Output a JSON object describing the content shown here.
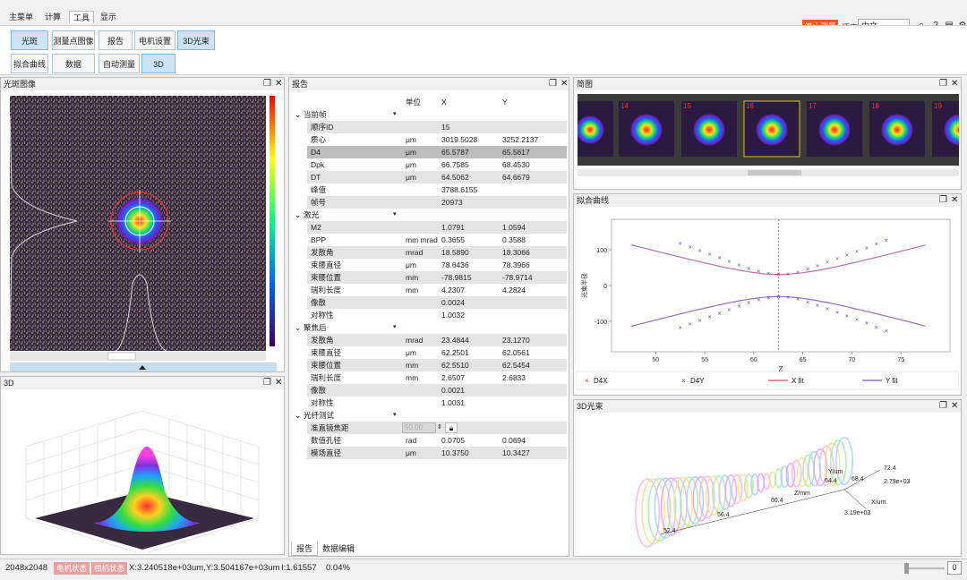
{
  "menu": {
    "items": [
      "主菜单",
      "计算",
      "工具",
      "显示"
    ],
    "active_index": 2
  },
  "ribbon": {
    "row1": [
      "光斑",
      "测量点图像",
      "报告",
      "电机设置",
      "3D光束"
    ],
    "row2": [
      "拟合曲线",
      "数据",
      "自动测量",
      "3D"
    ]
  },
  "topbar": {
    "stop_label": "停止测量",
    "lang_label": "语言",
    "lang_value": "中文"
  },
  "panels": {
    "beam_image": "光斑图像",
    "report": "报告",
    "thumbnails": "简图",
    "fit_curve": "拟合曲线",
    "view3d": "3D",
    "beam3d": "3D光束"
  },
  "report": {
    "headers": {
      "unit": "单位",
      "x": "X",
      "y": "Y"
    },
    "groups": [
      {
        "name": "当前帧",
        "rows": [
          [
            "顺序ID",
            "",
            "15",
            ""
          ],
          [
            "质心",
            "μm",
            "3019.5028",
            "3252.2137"
          ],
          [
            "D4",
            "μm",
            "65.5787",
            "65.5617"
          ],
          [
            "Dpk",
            "μm",
            "66.7585",
            "68.4530"
          ],
          [
            "DT",
            "μm",
            "64.5062",
            "64.6679"
          ],
          [
            "峰值",
            "",
            "3788.6155",
            ""
          ],
          [
            "帧号",
            "",
            "20973",
            ""
          ]
        ]
      },
      {
        "name": "激光",
        "rows": [
          [
            "M2",
            "",
            "1.0791",
            "1.0594"
          ],
          [
            "BPP",
            "mm mrad",
            "0.3655",
            "0.3588"
          ],
          [
            "发散角",
            "mrad",
            "18.5890",
            "18.3066"
          ],
          [
            "束腰直径",
            "μm",
            "78.6436",
            "78.3966"
          ],
          [
            "束腰位置",
            "mm",
            "-78.9815",
            "-78.9714"
          ],
          [
            "瑞利长度",
            "mm",
            "4.2307",
            "4.2824"
          ],
          [
            "像散",
            "",
            "0.0024",
            ""
          ],
          [
            "对称性",
            "",
            "1.0032",
            ""
          ]
        ]
      },
      {
        "name": "聚焦后",
        "rows": [
          [
            "发散角",
            "mrad",
            "23.4844",
            "23.1270"
          ],
          [
            "束腰直径",
            "μm",
            "62.2501",
            "62.0561"
          ],
          [
            "束腰位置",
            "mm",
            "62.5510",
            "62.5454"
          ],
          [
            "瑞利长度",
            "mm",
            "2.6507",
            "2.6833"
          ],
          [
            "像散",
            "",
            "0.0021",
            ""
          ],
          [
            "对称性",
            "",
            "1.0031",
            ""
          ]
        ]
      },
      {
        "name": "光纤测试",
        "rows": [
          [
            "准直镜焦距",
            "",
            "50.00",
            ""
          ],
          [
            "数值孔径",
            "rad",
            "0.0705",
            "0.0694"
          ],
          [
            "模场直径",
            "μm",
            "10.3750",
            "10.3427"
          ]
        ]
      }
    ],
    "tabs": [
      "报告",
      "数据编辑"
    ]
  },
  "thumbnails": {
    "labels": [
      "14",
      "15",
      "16",
      "17",
      "18",
      "19"
    ]
  },
  "fit_chart": {
    "ylabel": "光束半径",
    "xlabel": "Z",
    "xticks": [
      "50",
      "55",
      "60",
      "65",
      "70",
      "75"
    ],
    "yticks": [
      "100",
      "0",
      "-100"
    ],
    "legend": [
      "D4X",
      "D4Y",
      "X fit",
      "Y fit"
    ]
  },
  "chart_data": {
    "type": "scatter",
    "xlabel": "Z",
    "ylabel": "光束半径",
    "xlim": [
      45.5,
      80
    ],
    "ylim": [
      -185,
      185
    ],
    "waist_z": 62.55,
    "waist_r": 31.1,
    "rayleigh": 2.65,
    "series": [
      {
        "name": "D4X",
        "x": [
          52.5,
          53.5,
          54.5,
          55.5,
          56.5,
          57.5,
          58.5,
          59.5,
          60.5,
          61.5,
          62.5,
          63.5,
          64.5,
          65.5,
          66.5,
          67.5,
          68.5,
          69.5,
          70.5,
          71.5,
          72.5,
          73.5
        ],
        "y": [
          118,
          108,
          97,
          88,
          77,
          67,
          57,
          47,
          40,
          34,
          31,
          33,
          38,
          46,
          55,
          65,
          75,
          85,
          95,
          105,
          116,
          126
        ]
      },
      {
        "name": "D4Y",
        "x": [
          52.5,
          53.5,
          54.5,
          55.5,
          56.5,
          57.5,
          58.5,
          59.5,
          60.5,
          61.5,
          62.5,
          63.5,
          64.5,
          65.5,
          66.5,
          67.5,
          68.5,
          69.5,
          70.5,
          71.5,
          72.5,
          73.5
        ],
        "y": [
          -118,
          -108,
          -97,
          -88,
          -77,
          -67,
          -57,
          -47,
          -40,
          -34,
          -31,
          -33,
          -38,
          -46,
          -55,
          -65,
          -75,
          -85,
          -95,
          -105,
          -116,
          -126
        ]
      }
    ]
  },
  "beam3d": {
    "labels": [
      "52.4",
      "56.4",
      "60.4",
      "Z/mm",
      "64.4",
      "68.4",
      "Y/um",
      "72.4",
      "2.79e+03",
      "X/um",
      "3.19e+03"
    ]
  },
  "status": {
    "resolution": "2048x2048",
    "badge1": "电机状态",
    "badge2": "相机状态",
    "coords": "X:3.240518e+03um,Y:3.504167e+03um",
    "intensity": "I:1.61557",
    "percent": "0.04%",
    "zoom_value": "0"
  },
  "colors": {
    "accent": "#f05a28",
    "fit_x": "#d05050",
    "fit_y": "#7a5aa8",
    "marker": "#6040a0"
  }
}
